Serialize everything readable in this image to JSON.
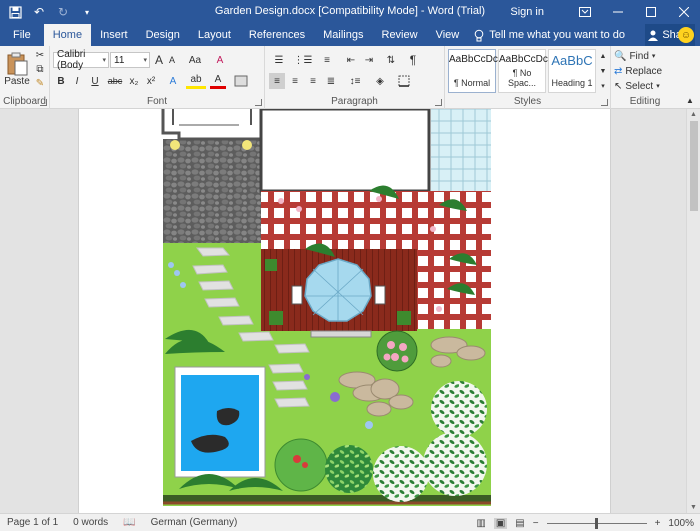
{
  "window": {
    "title": "Garden Design.docx [Compatibility Mode] - Word (Trial)",
    "sign_in": "Sign in",
    "minimize": "🗕",
    "restore": "🗗",
    "close": "✕"
  },
  "quick_access": {
    "save_icon": "save-icon",
    "undo_icon": "undo-icon",
    "redo_icon": "redo-icon",
    "customize_icon": "customize-icon"
  },
  "tabs": [
    "File",
    "Home",
    "Insert",
    "Design",
    "Layout",
    "References",
    "Mailings",
    "Review",
    "View"
  ],
  "active_tab": "Home",
  "tell_me": "Tell me what you want to do",
  "share": "Share",
  "ribbon": {
    "clipboard": {
      "label": "Clipboard",
      "paste": "Paste"
    },
    "font": {
      "label": "Font",
      "font_name": "Calibri (Body",
      "font_size": "11",
      "buttons": {
        "bold": "B",
        "italic": "I",
        "underline": "U",
        "strike": "abc",
        "sub": "x₂",
        "sup": "x²",
        "grow": "A",
        "shrink": "A",
        "case": "Aa",
        "clear": "A",
        "effects": "A",
        "highlight": "ab",
        "color": "A"
      }
    },
    "paragraph": {
      "label": "Paragraph"
    },
    "styles": {
      "label": "Styles",
      "items": [
        {
          "sample": "AaBbCcDc",
          "name": "¶ Normal"
        },
        {
          "sample": "AaBbCcDc",
          "name": "¶ No Spac..."
        },
        {
          "sample": "AaBbC",
          "name": "Heading 1"
        }
      ]
    },
    "editing": {
      "label": "Editing",
      "find": "Find",
      "replace": "Replace",
      "select": "Select"
    }
  },
  "status": {
    "page": "Page 1 of 1",
    "words": "0 words",
    "language": "German (Germany)",
    "zoom": "100%",
    "zoom_value": 100
  },
  "colors": {
    "brand": "#2b579a",
    "lawn": "#8fd24a",
    "deck": "#8a2a1c",
    "pergola": "#9b2b26",
    "stone": "#6e6e6e",
    "pool": "#1ea7f0"
  }
}
